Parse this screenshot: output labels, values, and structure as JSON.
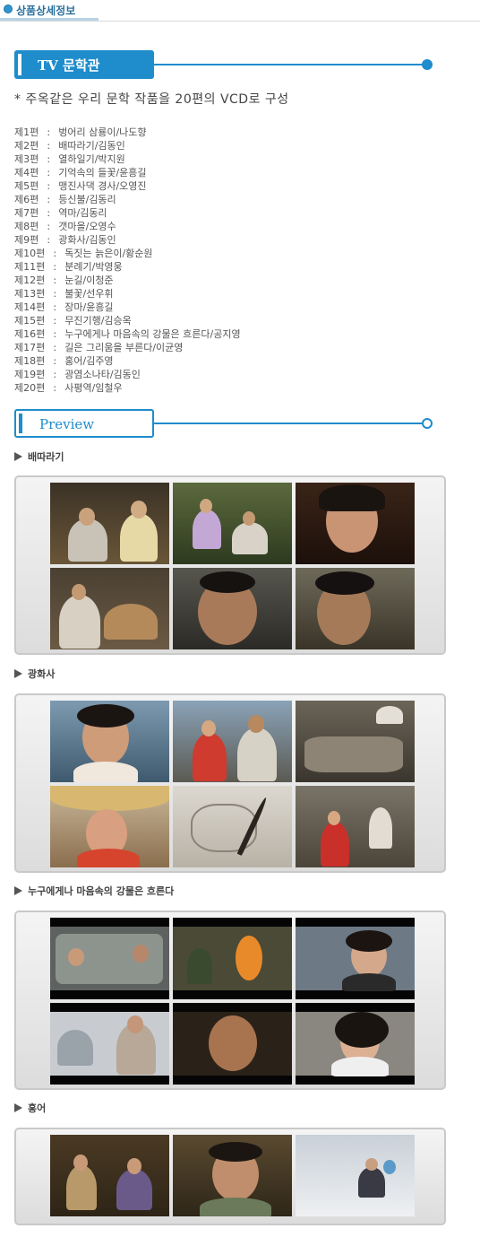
{
  "header": {
    "title": "상품상세정보"
  },
  "banner_main": {
    "label": "TV 문학관"
  },
  "intro": "* 주옥같은 우리 문학 작품을 20편의 VCD로 구성",
  "episodes": [
    {
      "num": "제1편",
      "title": "벙어리 삼룡이/나도향"
    },
    {
      "num": "제2편",
      "title": "배따라기/김동인"
    },
    {
      "num": "제3편",
      "title": "열하일기/박지원"
    },
    {
      "num": "제4편",
      "title": "기억속의 들꽃/윤흥길"
    },
    {
      "num": "제5편",
      "title": "맹진사댁 경사/오영진"
    },
    {
      "num": "제6편",
      "title": "등신불/김동리"
    },
    {
      "num": "제7편",
      "title": "역마/김동리"
    },
    {
      "num": "제8편",
      "title": "갯마을/오영수"
    },
    {
      "num": "제9편",
      "title": "광화사/김동인"
    },
    {
      "num": "제10편",
      "title": "독짓는 늙은이/황순원"
    },
    {
      "num": "제11편",
      "title": "분례기/박영웅"
    },
    {
      "num": "제12편",
      "title": "눈길/이청준"
    },
    {
      "num": "제13편",
      "title": "불꽃/선우휘"
    },
    {
      "num": "제14편",
      "title": "장마/윤흥길"
    },
    {
      "num": "제15편",
      "title": "무진기행/김승옥"
    },
    {
      "num": "제16편",
      "title": "누구에게나 마음속의 강물은 흐른다/공지영"
    },
    {
      "num": "제17편",
      "title": "길은 그리움을 부른다/이균영"
    },
    {
      "num": "제18편",
      "title": "홍어/김주영"
    },
    {
      "num": "제19편",
      "title": "광염소나타/김동인"
    },
    {
      "num": "제20편",
      "title": "사평역/임철우"
    }
  ],
  "episode_separator": ":",
  "banner_preview": {
    "label": "Preview"
  },
  "previews": [
    {
      "title": "배따라기"
    },
    {
      "title": "광화사"
    },
    {
      "title": "누구에게나 마음속의 강물은 흐른다"
    },
    {
      "title": "홍어"
    }
  ],
  "colors": {
    "accent": "#1f8ccc",
    "frame": "#c9c9c9"
  }
}
